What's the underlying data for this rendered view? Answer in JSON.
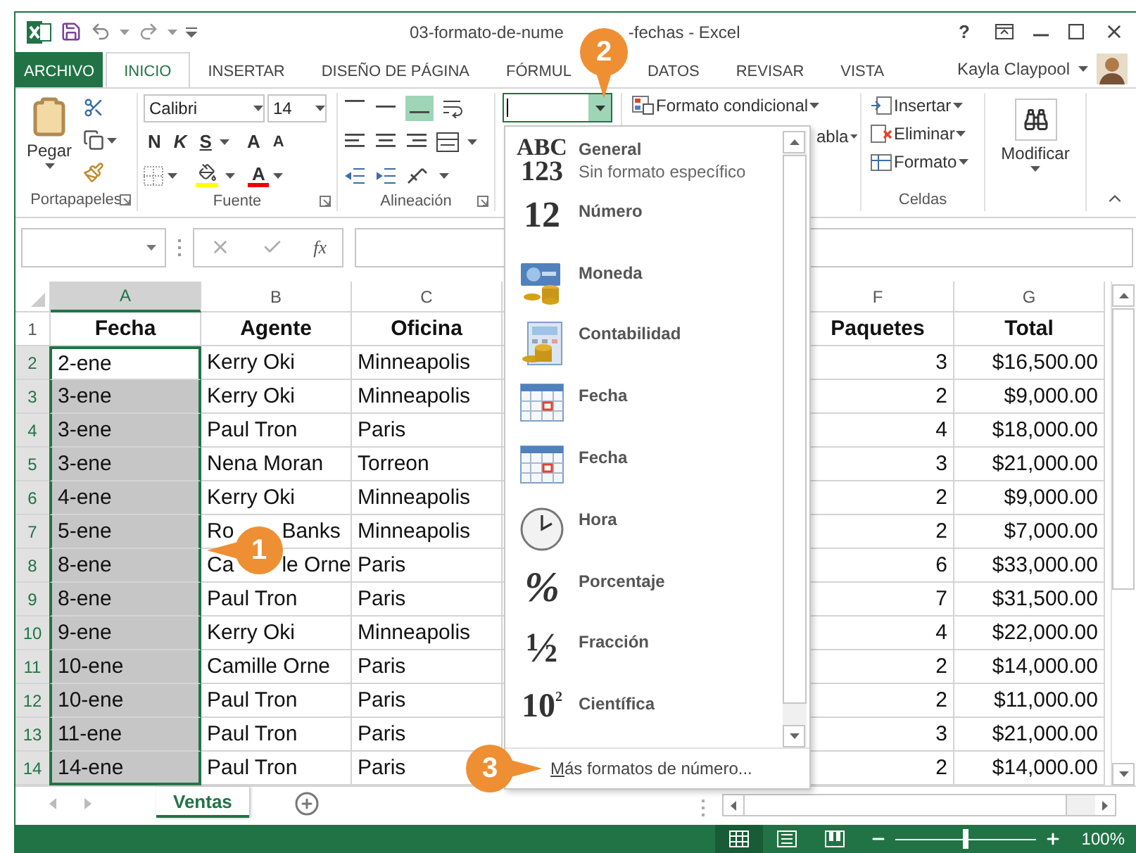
{
  "window": {
    "title_parts": [
      "03-formato-de-nume",
      "-fechas - Excel"
    ],
    "help": "?"
  },
  "ribbon_tabs": [
    {
      "label": "ARCHIVO",
      "kind": "file",
      "selected": false
    },
    {
      "label": "INICIO",
      "kind": "tab",
      "selected": true
    },
    {
      "label": "INSERTAR",
      "kind": "tab",
      "selected": false
    },
    {
      "label": "DISEÑO DE PÁGINA",
      "kind": "tab",
      "selected": false
    },
    {
      "label": "FÓRMUL",
      "kind": "clipped",
      "selected": false
    },
    {
      "label": "DATOS",
      "kind": "tab",
      "selected": false
    },
    {
      "label": "REVISAR",
      "kind": "tab",
      "selected": false
    },
    {
      "label": "VISTA",
      "kind": "tab",
      "selected": false
    }
  ],
  "user": {
    "name": "Kayla Claypool"
  },
  "ribbon": {
    "clipboard": {
      "paste": "Pegar",
      "group": "Portapapeles"
    },
    "font": {
      "name": "Calibri",
      "size": "14",
      "bold": "N",
      "italic": "K",
      "underline": "S",
      "grow": "A",
      "shrink": "A",
      "color_letter": "A",
      "group": "Fuente"
    },
    "alignment": {
      "group": "Alineación"
    },
    "styles": {
      "conditional": "Formato condicional",
      "table": "abla"
    },
    "cells": {
      "insert": "Insertar",
      "delete": "Eliminar",
      "format": "Formato",
      "group": "Celdas"
    },
    "editing": {
      "label": "Modificar"
    }
  },
  "formula_bar": {
    "fx": "fx"
  },
  "grid": {
    "columns": [
      {
        "letter": "A",
        "selected": true
      },
      {
        "letter": "B",
        "selected": false
      },
      {
        "letter": "C",
        "selected": false
      },
      {
        "letter": "F",
        "selected": false
      },
      {
        "letter": "G",
        "selected": false
      }
    ],
    "rows": [
      {
        "num": "1",
        "kind": "header",
        "selected": false,
        "cells": [
          "Fecha",
          "Agente",
          "Oficina",
          "Paquetes",
          "Total"
        ]
      },
      {
        "num": "2",
        "kind": "data",
        "selected": true,
        "active": true,
        "cells": [
          "2-ene",
          "Kerry Oki",
          "Minneapolis",
          "3",
          "$16,500.00"
        ]
      },
      {
        "num": "3",
        "kind": "data",
        "selected": true,
        "cells": [
          "3-ene",
          "Kerry Oki",
          "Minneapolis",
          "2",
          "$9,000.00"
        ]
      },
      {
        "num": "4",
        "kind": "data",
        "selected": true,
        "cells": [
          "3-ene",
          "Paul Tron",
          "Paris",
          "4",
          "$18,000.00"
        ]
      },
      {
        "num": "5",
        "kind": "data",
        "selected": true,
        "cells": [
          "3-ene",
          "Nena Moran",
          "Torreon",
          "3",
          "$21,000.00"
        ]
      },
      {
        "num": "6",
        "kind": "data",
        "selected": true,
        "cells": [
          "4-ene",
          "Kerry Oki",
          "Minneapolis",
          "2",
          "$9,000.00"
        ]
      },
      {
        "num": "7",
        "kind": "data",
        "selected": true,
        "cells": [
          "5-ene",
          [
            "Ro",
            "Banks"
          ],
          "Minneapolis",
          "2",
          "$7,000.00"
        ]
      },
      {
        "num": "8",
        "kind": "data",
        "selected": true,
        "cells": [
          "8-ene",
          [
            "Ca",
            "le Orne"
          ],
          "Paris",
          "6",
          "$33,000.00"
        ]
      },
      {
        "num": "9",
        "kind": "data",
        "selected": true,
        "cells": [
          "8-ene",
          "Paul Tron",
          "Paris",
          "7",
          "$31,500.00"
        ]
      },
      {
        "num": "10",
        "kind": "data",
        "selected": true,
        "cells": [
          "9-ene",
          "Kerry Oki",
          "Minneapolis",
          "4",
          "$22,000.00"
        ]
      },
      {
        "num": "11",
        "kind": "data",
        "selected": true,
        "cells": [
          "10-ene",
          "Camille Orne",
          "Paris",
          "2",
          "$14,000.00"
        ]
      },
      {
        "num": "12",
        "kind": "data",
        "selected": true,
        "cells": [
          "10-ene",
          "Paul Tron",
          "Paris",
          "2",
          "$11,000.00"
        ]
      },
      {
        "num": "13",
        "kind": "data",
        "selected": true,
        "cells": [
          "11-ene",
          "Paul Tron",
          "Paris",
          "3",
          "$21,000.00"
        ]
      },
      {
        "num": "14",
        "kind": "data",
        "selected": true,
        "cells": [
          "14-ene",
          "Paul Tron",
          "Paris",
          "2",
          "$14,000.00"
        ]
      }
    ]
  },
  "format_menu": {
    "items": [
      {
        "kind": "general",
        "glyph": [
          "ABC",
          "123"
        ],
        "label": "General",
        "detail": "Sin formato específico"
      },
      {
        "kind": "number",
        "glyph": [
          "12"
        ],
        "label": "Número"
      },
      {
        "kind": "currency",
        "label": "Moneda"
      },
      {
        "kind": "accounting",
        "label": "Contabilidad"
      },
      {
        "kind": "date",
        "label": "Fecha"
      },
      {
        "kind": "date",
        "label": "Fecha"
      },
      {
        "kind": "time",
        "label": "Hora"
      },
      {
        "kind": "percent",
        "glyph": [
          "%"
        ],
        "label": "Porcentaje"
      },
      {
        "kind": "fraction",
        "glyph": [
          "½"
        ],
        "label": "Fracción"
      },
      {
        "kind": "scientific",
        "glyph": [
          "10",
          "2"
        ],
        "label": "Científica"
      }
    ],
    "more": "Más formatos de número..."
  },
  "callouts": [
    "1",
    "2",
    "3"
  ],
  "sheet_tabs": [
    {
      "label": "Ventas",
      "selected": true
    }
  ],
  "status_bar": {
    "views": [
      {
        "kind": "normal",
        "selected": true
      },
      {
        "kind": "page_layout",
        "selected": false
      },
      {
        "kind": "page_break",
        "selected": false
      }
    ],
    "zoom": {
      "level": 0.5,
      "reading": "100%"
    }
  }
}
